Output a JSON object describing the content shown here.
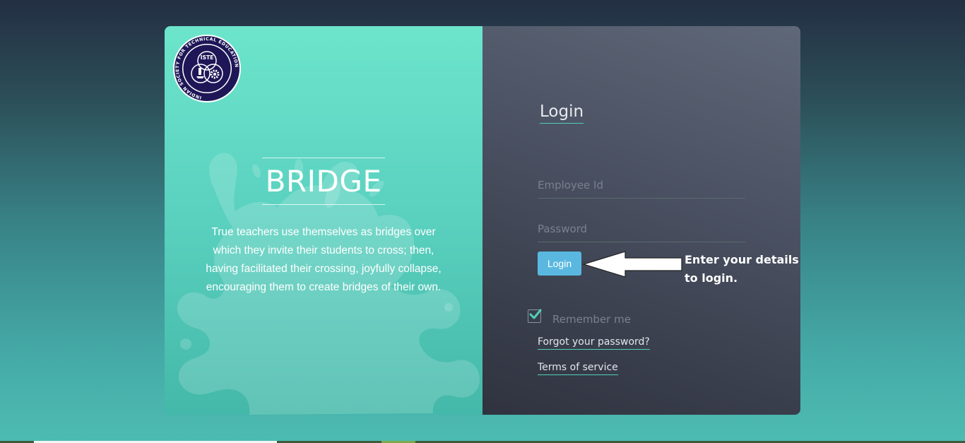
{
  "logo": {
    "ring_text": "INDIAN SOCIETY FOR TECHNICAL EDUCATION",
    "center_text": "ISTE"
  },
  "hero": {
    "title": "BRIDGE",
    "quote": "True teachers use themselves as bridges over which they invite their students to cross; then, having facilitated their crossing, joyfully collapse, encouraging them to create bridges of their own."
  },
  "login": {
    "heading": "Login",
    "employee_placeholder": "Employee Id",
    "password_placeholder": "Password",
    "button_label": "Login",
    "remember_label": "Remember me",
    "remember_checked": true,
    "forgot_link": "Forgot your password?",
    "terms_link": "Terms of service"
  },
  "annotation": {
    "line1": "Enter your details",
    "line2": "to login."
  },
  "colors": {
    "accent_teal": "#4fd1b7",
    "button_blue": "#5ab8e0",
    "left_panel_top": "#6ce5cc",
    "right_panel": "#4b5263"
  }
}
